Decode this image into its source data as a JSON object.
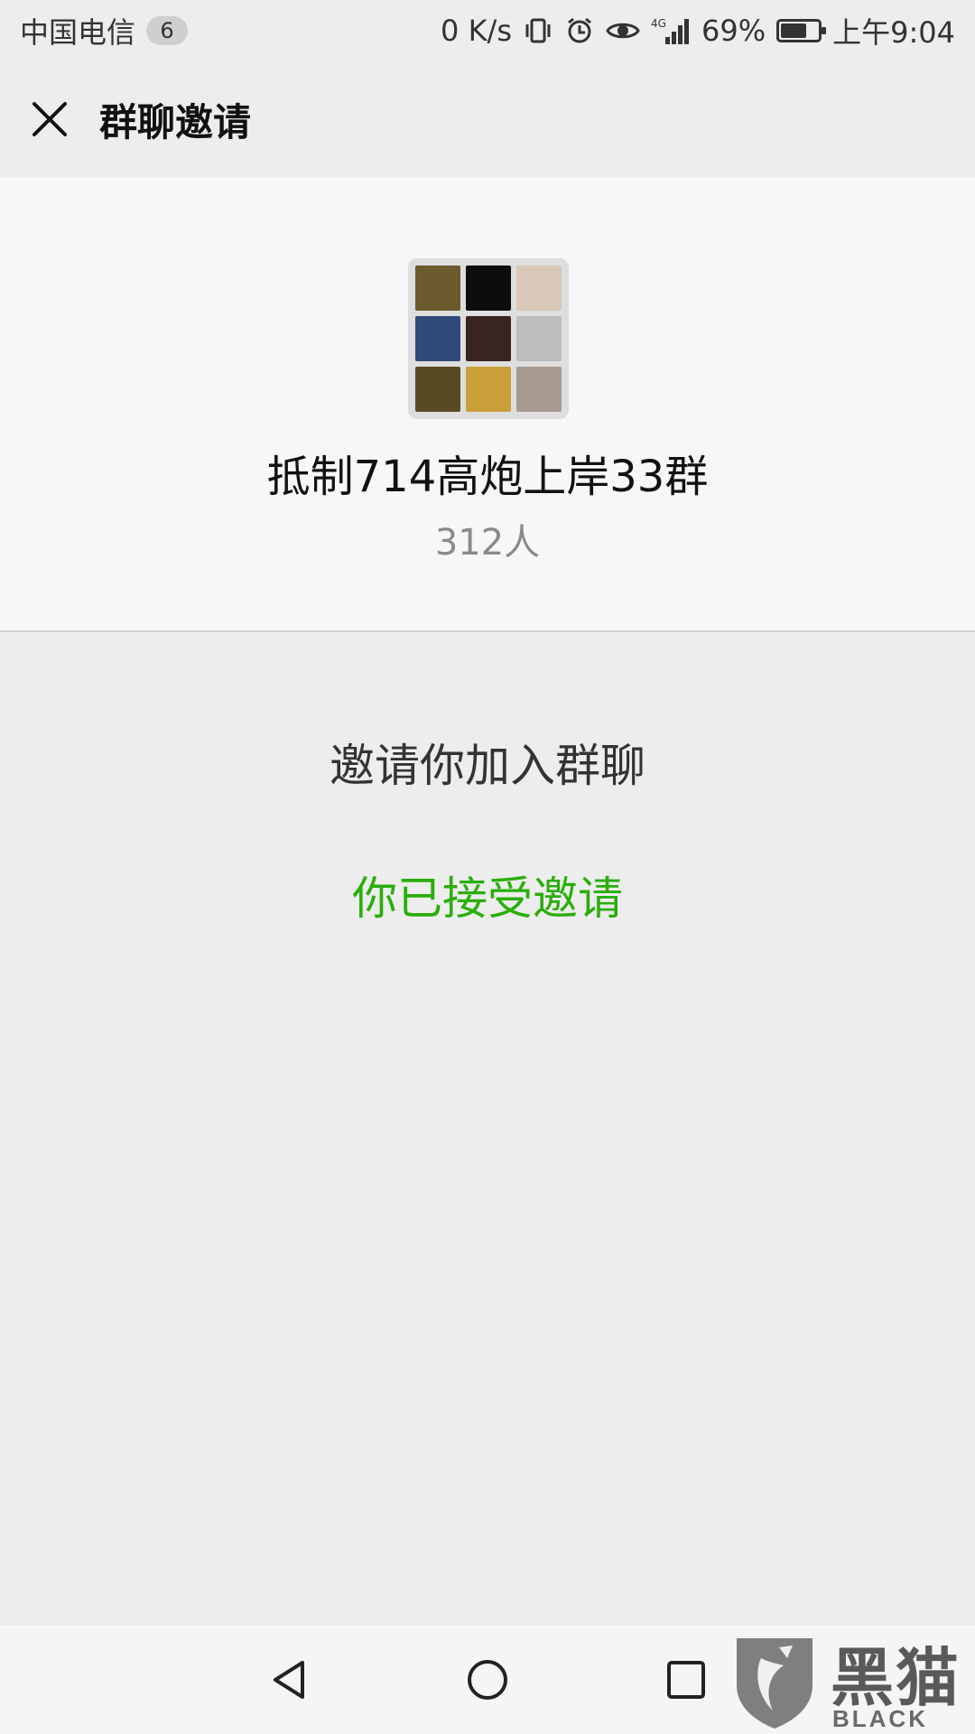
{
  "status_bar": {
    "carrier": "中国电信",
    "notification_count": "6",
    "net_speed": "0 K/s",
    "network": "4G",
    "battery_percent": "69%",
    "battery_level": 0.69,
    "time": "上午9:04",
    "icons": [
      "vibrate-icon",
      "alarm-icon",
      "eye-icon",
      "signal-icon",
      "battery-icon"
    ]
  },
  "header": {
    "title": "群聊邀请",
    "close_icon": "close-icon"
  },
  "group": {
    "name": "抵制714高炮上岸33群",
    "member_count": "312人",
    "avatar_tiles": [
      "#6a5a2c",
      "#0d0d0d",
      "#d9c8b8",
      "#2f4a78",
      "#3a2420",
      "#bdbdbd",
      "#5a4a24",
      "#c9a03a",
      "#a89a90"
    ]
  },
  "invite": {
    "message": "邀请你加入群聊",
    "status": "你已接受邀请",
    "status_color": "#2aae0a"
  },
  "nav": {
    "icons": [
      "back-icon",
      "home-icon",
      "recents-icon"
    ]
  },
  "watermark": {
    "title": "黑猫",
    "subtitle": "BLACK CAT"
  }
}
